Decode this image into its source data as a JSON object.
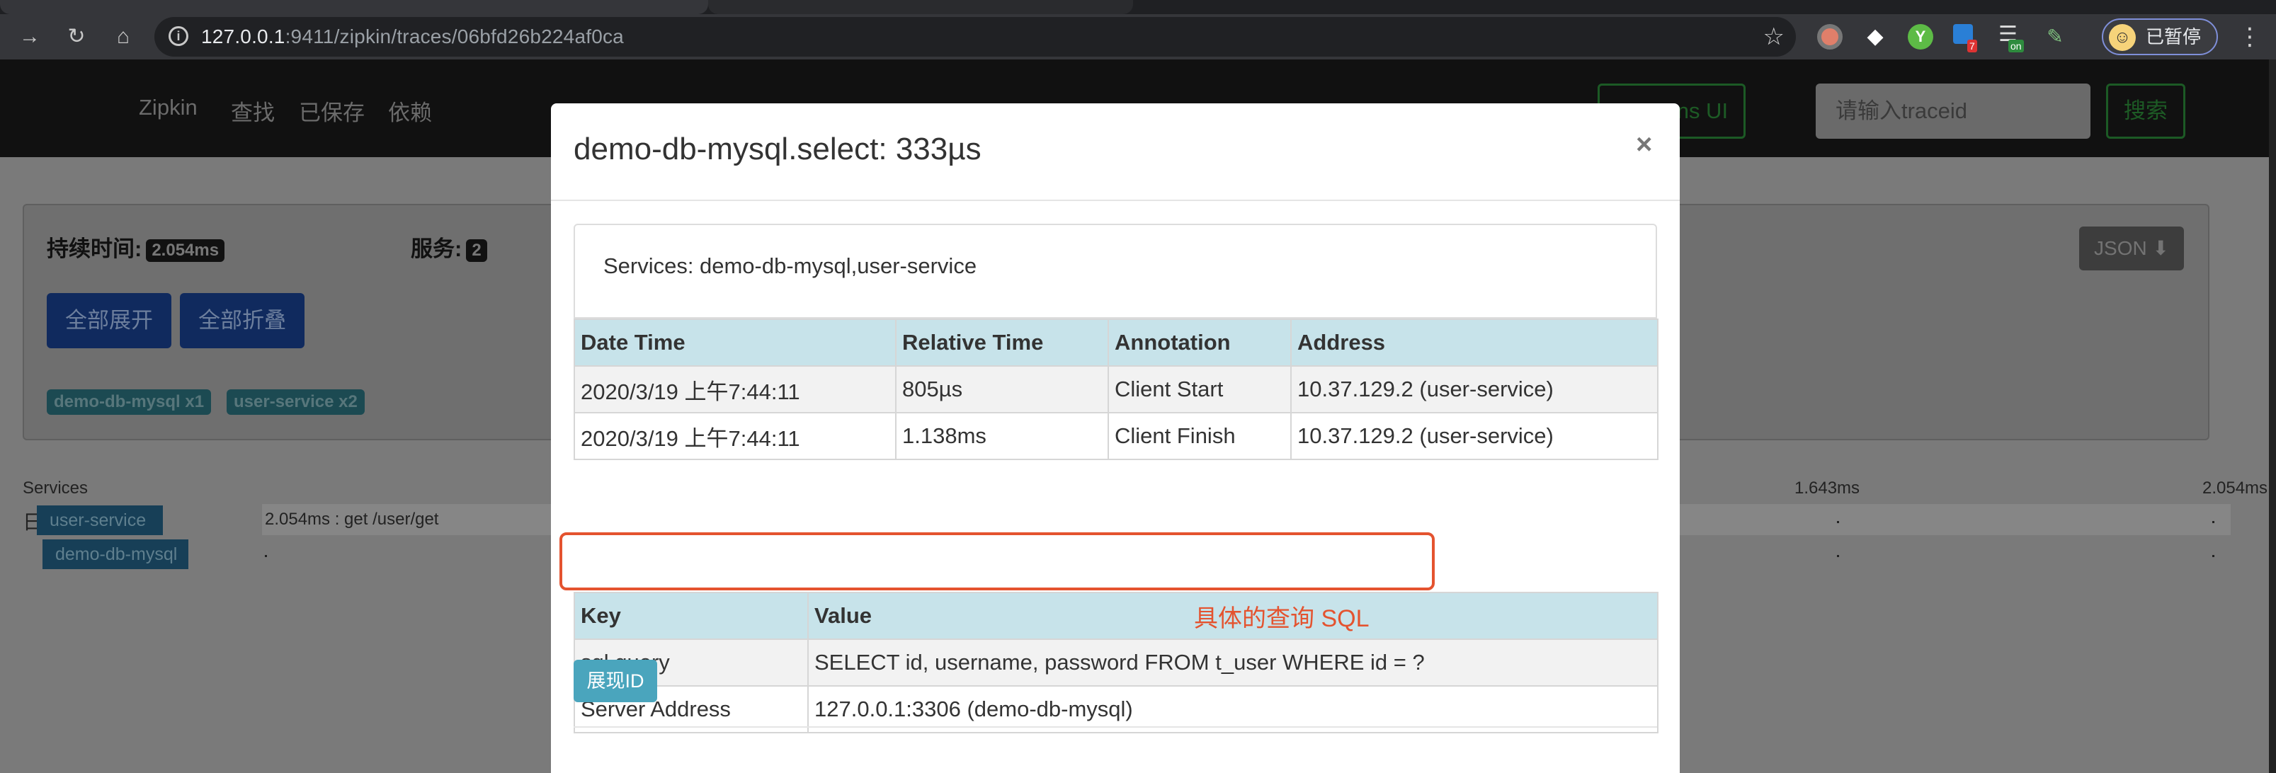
{
  "browser": {
    "url_host": "127.0.0.1",
    "url_rest": ":9411/zipkin/traces/06bfd26b224af0ca",
    "pause_label": "已暂停",
    "ext_badges": [
      "7",
      "on"
    ]
  },
  "nav": {
    "brand": "Zipkin",
    "links": [
      "查找",
      "已保存",
      "依赖"
    ],
    "lens_button": "Try Lens UI",
    "traceid_placeholder": "请输入traceid",
    "search_button": "搜索"
  },
  "summary": {
    "duration_label": "持续时间:",
    "duration_value": "2.054ms",
    "services_label": "服务:",
    "services_value": "2",
    "expand_all": "全部展开",
    "collapse_all": "全部折叠",
    "service_badges": [
      "demo-db-mysql x1",
      "user-service x2"
    ],
    "json_button": "JSON"
  },
  "timeline": {
    "services_header": "Services",
    "tick_mid": "1.643ms",
    "tick_end": "2.054ms",
    "rows": [
      {
        "service": "user-service",
        "span": "2.054ms : get /user/get"
      },
      {
        "service": "demo-db-mysql",
        "span": ""
      }
    ],
    "collapse_glyph": "日"
  },
  "modal": {
    "title": "demo-db-mysql.select: 333µs",
    "close": "×",
    "services_label": "Services:",
    "services_value": "demo-db-mysql,user-service",
    "annotations": {
      "headers": [
        "Date Time",
        "Relative Time",
        "Annotation",
        "Address"
      ],
      "rows": [
        [
          "2020/3/19 上午7:44:11",
          "805µs",
          "Client Start",
          "10.37.129.2 (user-service)"
        ],
        [
          "2020/3/19 上午7:44:11",
          "1.138ms",
          "Client Finish",
          "10.37.129.2 (user-service)"
        ]
      ]
    },
    "tags": {
      "headers": [
        "Key",
        "Value"
      ],
      "rows": [
        [
          "sql.query",
          "SELECT id, username, password FROM t_user WHERE id = ?"
        ],
        [
          "Server Address",
          "127.0.0.1:3306 (demo-db-mysql)"
        ]
      ]
    },
    "annotation_note": "具体的查询 SQL",
    "show_id_button": "展现ID"
  },
  "colors": {
    "highlight": "#e4532f",
    "table_header": "#c7e3ea",
    "show_id_button": "#4aa5bd"
  }
}
